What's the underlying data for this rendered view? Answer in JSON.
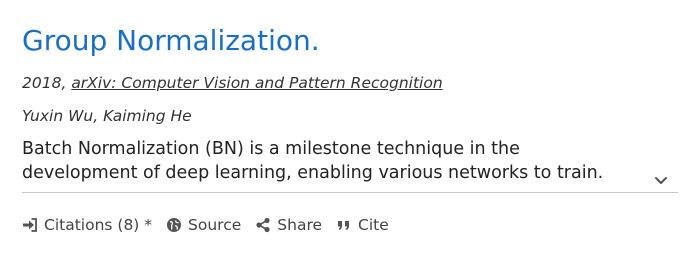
{
  "paper": {
    "title": "Group Normalization.",
    "year": "2018,",
    "venue": "arXiv: Computer Vision and Pattern Recognition",
    "authors": "Yuxin Wu, Kaiming He",
    "abstract_lines": [
      "Batch Normalization (BN) is a milestone technique in the",
      "development of deep learning, enabling various networks to train."
    ]
  },
  "actions": {
    "citations_label": "Citations (8) *",
    "source_label": "Source",
    "share_label": "Share",
    "cite_label": "Cite"
  },
  "colors": {
    "title": "#1a6fc4",
    "text": "#222222",
    "icon": "#555555",
    "divider": "#c8c8c8"
  },
  "icons": [
    "sign-in-icon",
    "globe-icon",
    "share-icon",
    "quote-icon",
    "chevron-down-icon"
  ]
}
